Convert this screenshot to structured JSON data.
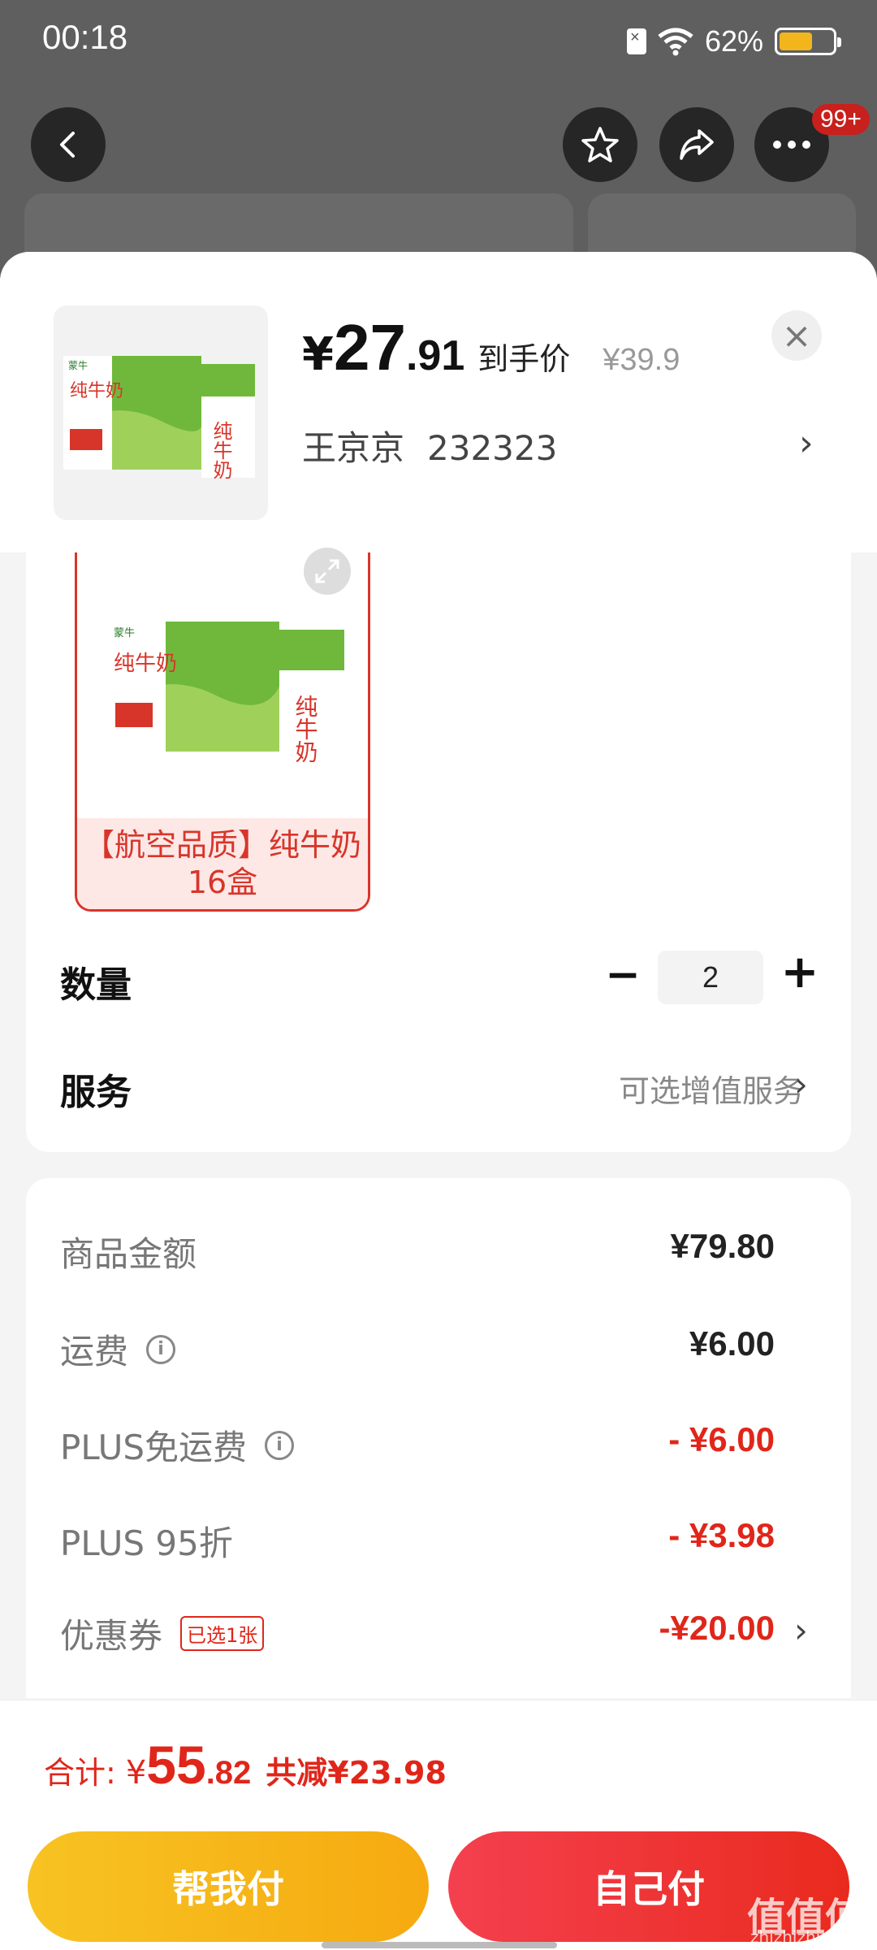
{
  "status_bar": {
    "time": "00:18",
    "battery": "62%",
    "battery_level": 0.62,
    "icons": [
      "sim-off-icon",
      "wifi-icon",
      "battery-icon"
    ]
  },
  "nav": {
    "badge": "99+",
    "icons": [
      "back-arrow-icon",
      "star-icon",
      "share-icon",
      "more-dots-icon"
    ]
  },
  "product": {
    "price_yen": "¥",
    "price_int": "27",
    "price_dec": ".91",
    "price_tag": "到手价",
    "original_price": "¥39.9",
    "recipient_name": "王京京",
    "recipient_phone": "232323",
    "box_brand": "蒙牛",
    "box_title": "纯牛奶"
  },
  "variant": {
    "label": "【航空品质】纯牛奶16盒"
  },
  "quantity": {
    "label": "数量",
    "minus": "−",
    "value": "2",
    "plus": "+"
  },
  "service": {
    "label": "服务",
    "value": "可选增值服务"
  },
  "costs": {
    "goods_label": "商品金额",
    "goods_value": "¥79.80",
    "shipping_label": "运费",
    "shipping_value": "¥6.00",
    "plus_free_label": "PLUS免运费",
    "plus_free_value": "- ¥6.00",
    "plus_discount_label": "PLUS 95折",
    "plus_discount_value": "- ¥3.98",
    "coupon_label": "优惠券",
    "coupon_tag": "已选1张",
    "coupon_value": "-¥20.00"
  },
  "footer": {
    "total_label": "合计:",
    "total_yen": "¥",
    "total_int": "55",
    "total_dec": ".82",
    "saved": "共减¥23.98",
    "help_pay": "帮我付",
    "self_pay": "自己付",
    "watermark": "值值值",
    "watermark_sub": "zhizhizhi.com"
  },
  "colors": {
    "accent_red": "#e0261a",
    "help_yellow": "#f7c322",
    "self_red": "#e92a1e",
    "battery": "#f2b51b"
  }
}
